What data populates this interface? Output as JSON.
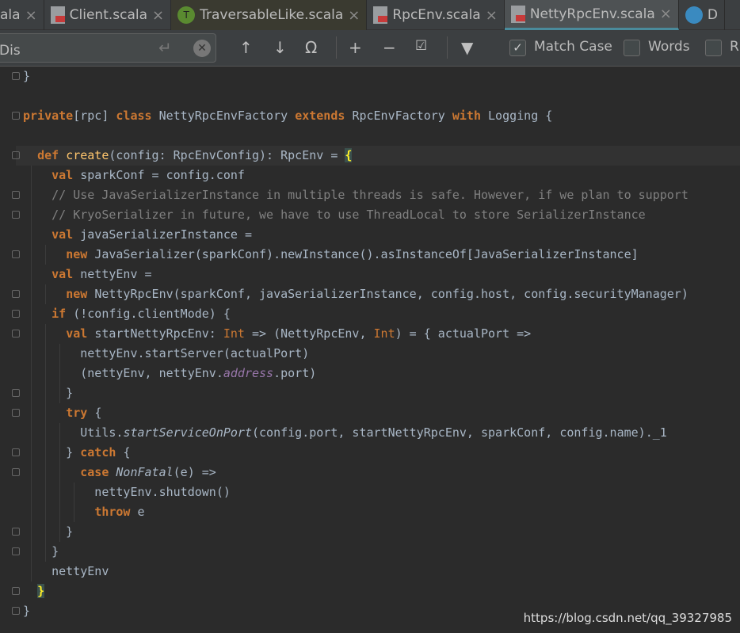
{
  "tabs": [
    {
      "label": "ala",
      "icon": "scala-file-icon"
    },
    {
      "label": "Client.scala",
      "icon": "scala-file-icon"
    },
    {
      "label": "TraversableLike.scala",
      "icon": "trait-icon"
    },
    {
      "label": "RpcEnv.scala",
      "icon": "scala-file-icon"
    },
    {
      "label": "NettyRpcEnv.scala",
      "icon": "scala-file-icon",
      "active": true
    },
    {
      "label": "D",
      "icon": "class-icon"
    }
  ],
  "find": {
    "query": "Dis",
    "match_case_label": "Match Case",
    "match_case_checked": true,
    "words_label": "Words",
    "words_checked": false,
    "regex_label": "R"
  },
  "code": [
    [
      [
        "",
        "}"
      ]
    ],
    [],
    [
      [
        "kw",
        "private"
      ],
      [
        "",
        "[rpc] "
      ],
      [
        "kw",
        "class "
      ],
      [
        "",
        "NettyRpcEnvFactory "
      ],
      [
        "kw",
        "extends "
      ],
      [
        "",
        "RpcEnvFactory "
      ],
      [
        "kw",
        "with "
      ],
      [
        "",
        "Logging {"
      ]
    ],
    [],
    [
      [
        "",
        "  "
      ],
      [
        "kw",
        "def "
      ],
      [
        "fn",
        "create"
      ],
      [
        "",
        "(config: RpcEnvConfig): RpcEnv = "
      ],
      [
        "br",
        "{"
      ]
    ],
    [
      [
        "",
        "    "
      ],
      [
        "kw",
        "val "
      ],
      [
        "",
        "sparkConf = config.conf"
      ]
    ],
    [
      [
        "cm",
        "    // Use JavaSerializerInstance in multiple threads is safe. However, if we plan to support"
      ]
    ],
    [
      [
        "cm",
        "    // KryoSerializer in future, we have to use ThreadLocal to store SerializerInstance"
      ]
    ],
    [
      [
        "",
        "    "
      ],
      [
        "kw",
        "val "
      ],
      [
        "",
        "javaSerializerInstance ="
      ]
    ],
    [
      [
        "",
        "      "
      ],
      [
        "kw",
        "new "
      ],
      [
        "",
        "JavaSerializer(sparkConf).newInstance().asInstanceOf[JavaSerializerInstance]"
      ]
    ],
    [
      [
        "",
        "    "
      ],
      [
        "kw",
        "val "
      ],
      [
        "",
        "nettyEnv ="
      ]
    ],
    [
      [
        "",
        "      "
      ],
      [
        "kw",
        "new "
      ],
      [
        "",
        "NettyRpcEnv(sparkConf, javaSerializerInstance, config.host, config.securityManager)"
      ]
    ],
    [
      [
        "",
        "    "
      ],
      [
        "kw",
        "if "
      ],
      [
        "",
        "(!config.clientMode) {"
      ]
    ],
    [
      [
        "",
        "      "
      ],
      [
        "kw",
        "val "
      ],
      [
        "",
        "startNettyRpcEnv: "
      ],
      [
        "ty",
        "Int"
      ],
      [
        "",
        " => (NettyRpcEnv, "
      ],
      [
        "ty",
        "Int"
      ],
      [
        "",
        ") = { actualPort =>"
      ]
    ],
    [
      [
        "",
        "        nettyEnv.startServer(actualPort)"
      ]
    ],
    [
      [
        "",
        "        (nettyEnv, nettyEnv."
      ],
      [
        "pr",
        "address"
      ],
      [
        "",
        ".port)"
      ]
    ],
    [
      [
        "",
        "      }"
      ]
    ],
    [
      [
        "",
        "      "
      ],
      [
        "kw",
        "try "
      ],
      [
        "",
        "{"
      ]
    ],
    [
      [
        "",
        "        Utils."
      ],
      [
        "it",
        "startServiceOnPort"
      ],
      [
        "",
        "(config.port, startNettyRpcEnv, sparkConf, config.name)._1"
      ]
    ],
    [
      [
        "",
        "      } "
      ],
      [
        "kw",
        "catch "
      ],
      [
        "",
        "{"
      ]
    ],
    [
      [
        "",
        "        "
      ],
      [
        "kw",
        "case "
      ],
      [
        "it",
        "NonFatal"
      ],
      [
        "",
        "(e) =>"
      ]
    ],
    [
      [
        "",
        "          nettyEnv.shutdown()"
      ]
    ],
    [
      [
        "",
        "          "
      ],
      [
        "kw",
        "throw "
      ],
      [
        "",
        "e"
      ]
    ],
    [
      [
        "",
        "      }"
      ]
    ],
    [
      [
        "",
        "    }"
      ]
    ],
    [
      [
        "",
        "    nettyEnv"
      ]
    ],
    [
      [
        "",
        "  "
      ],
      [
        "br",
        "}"
      ]
    ],
    [
      [
        "",
        "}"
      ]
    ]
  ],
  "watermark": "https://blog.csdn.net/qq_39327985"
}
